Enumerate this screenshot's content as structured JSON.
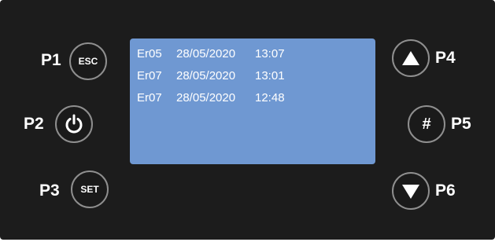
{
  "buttons": {
    "p1": {
      "label": "P1",
      "text": "ESC"
    },
    "p2": {
      "label": "P2"
    },
    "p3": {
      "label": "P3",
      "text": "SET"
    },
    "p4": {
      "label": "P4"
    },
    "p5": {
      "label": "P5",
      "text": "#"
    },
    "p6": {
      "label": "P6"
    }
  },
  "screen": {
    "rows": [
      {
        "code": "Er05",
        "date": "28/05/2020",
        "time": "13:07"
      },
      {
        "code": "Er07",
        "date": "28/05/2020",
        "time": "13:01"
      },
      {
        "code": "Er07",
        "date": "28/05/2020",
        "time": "12:48"
      }
    ]
  },
  "icons": {
    "p2": "power-icon",
    "p4": "triangle-up-icon",
    "p6": "triangle-down-icon"
  },
  "colors": {
    "panel": "#1c1c1c",
    "screen": "#6f98d2",
    "button_border": "#8f8f8f",
    "text": "#ffffff"
  }
}
